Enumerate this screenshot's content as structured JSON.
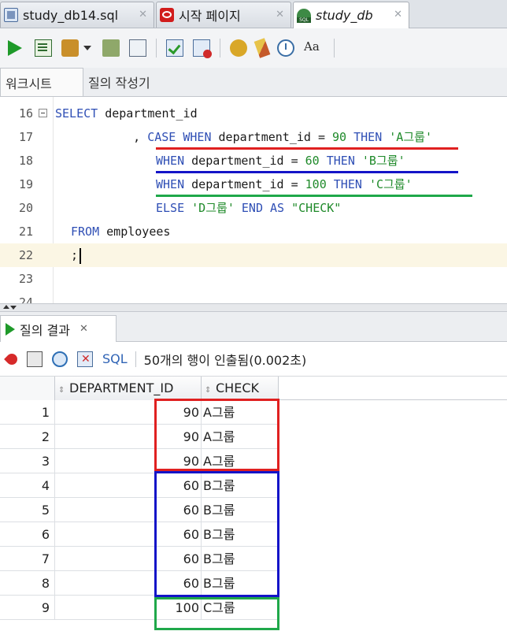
{
  "tabs": [
    {
      "label": "study_db14.sql",
      "icon": "sql-file-icon"
    },
    {
      "label": "시작 페이지",
      "icon": "start-page-icon"
    },
    {
      "label": "study_db",
      "icon": "db-connection-icon"
    }
  ],
  "subtabs": [
    "워크시트",
    "질의 작성기"
  ],
  "editor": {
    "lines": [
      {
        "no": "16",
        "tokens": [
          {
            "t": "SELECT",
            "c": "kw"
          },
          {
            "t": " department_id",
            "c": "plain"
          }
        ]
      },
      {
        "no": "17",
        "tokens": [
          {
            "t": "     , ",
            "c": "plain"
          },
          {
            "t": "CASE WHEN",
            "c": "kw"
          },
          {
            "t": " department_id = ",
            "c": "plain"
          },
          {
            "t": "90",
            "c": "num"
          },
          {
            "t": " THEN ",
            "c": "kw"
          },
          {
            "t": "'A그룹'",
            "c": "str"
          }
        ]
      },
      {
        "no": "18",
        "tokens": [
          {
            "t": "WHEN",
            "c": "kw"
          },
          {
            "t": " department_id = ",
            "c": "plain"
          },
          {
            "t": "60",
            "c": "num"
          },
          {
            "t": " THEN ",
            "c": "kw"
          },
          {
            "t": "'B그룹'",
            "c": "str"
          }
        ]
      },
      {
        "no": "19",
        "tokens": [
          {
            "t": "WHEN",
            "c": "kw"
          },
          {
            "t": " department_id = ",
            "c": "plain"
          },
          {
            "t": "100",
            "c": "num"
          },
          {
            "t": " THEN ",
            "c": "kw"
          },
          {
            "t": "'C그룹'",
            "c": "str"
          }
        ]
      },
      {
        "no": "20",
        "tokens": [
          {
            "t": "ELSE",
            "c": "kw"
          },
          {
            "t": " ",
            "c": "plain"
          },
          {
            "t": "'D그룹'",
            "c": "str"
          },
          {
            "t": " END AS ",
            "c": "kw"
          },
          {
            "t": "\"CHECK\"",
            "c": "str"
          }
        ]
      },
      {
        "no": "21",
        "tokens": [
          {
            "t": "FROM",
            "c": "kw"
          },
          {
            "t": " employees",
            "c": "plain"
          }
        ]
      },
      {
        "no": "22",
        "tokens": [
          {
            "t": ";",
            "c": "plain"
          }
        ]
      },
      {
        "no": "23",
        "tokens": []
      },
      {
        "no": "24",
        "tokens": []
      }
    ]
  },
  "results": {
    "tab_label": "질의 결과",
    "toolbar_sql": "SQL",
    "status": "50개의 행이 인출됨(0.002초)",
    "columns": [
      "DEPARTMENT_ID",
      "CHECK"
    ],
    "rows": [
      {
        "n": "1",
        "dept": "90",
        "check": "A그룹"
      },
      {
        "n": "2",
        "dept": "90",
        "check": "A그룹"
      },
      {
        "n": "3",
        "dept": "90",
        "check": "A그룹"
      },
      {
        "n": "4",
        "dept": "60",
        "check": "B그룹"
      },
      {
        "n": "5",
        "dept": "60",
        "check": "B그룹"
      },
      {
        "n": "6",
        "dept": "60",
        "check": "B그룹"
      },
      {
        "n": "7",
        "dept": "60",
        "check": "B그룹"
      },
      {
        "n": "8",
        "dept": "60",
        "check": "B그룹"
      },
      {
        "n": "9",
        "dept": "100",
        "check": "C그룹"
      }
    ]
  },
  "annotation_colors": {
    "a_group": "#e02020",
    "b_group": "#1414c8",
    "c_group": "#1fa84a"
  }
}
